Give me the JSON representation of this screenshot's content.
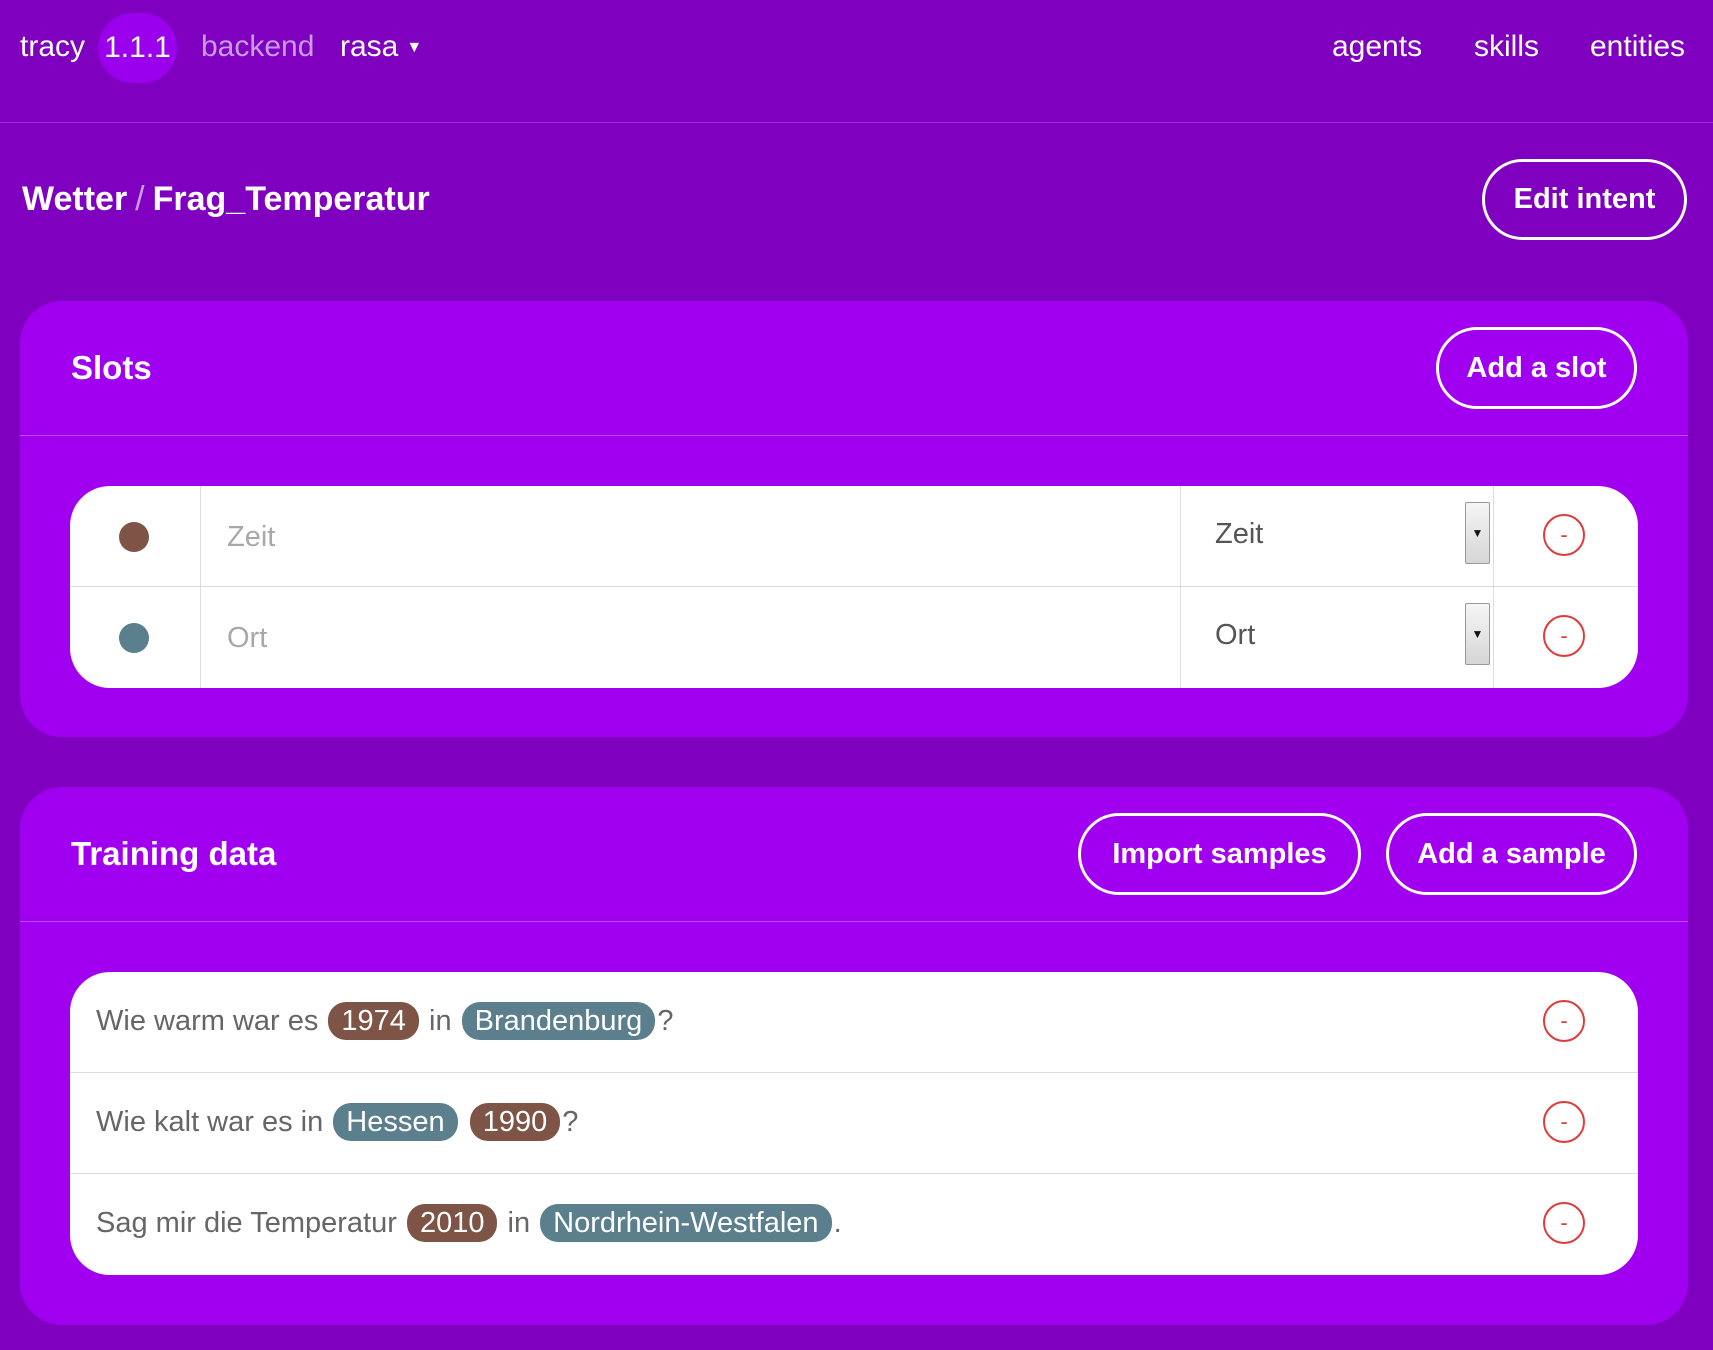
{
  "header": {
    "brand": "tracy",
    "version": "1.1.1",
    "backend_label": "backend",
    "backend_value": "rasa",
    "nav": [
      "agents",
      "skills",
      "entities"
    ]
  },
  "breadcrumb": {
    "parent": "Wetter",
    "separator": "/",
    "current": "Frag_Temperatur"
  },
  "edit_intent_label": "Edit intent",
  "slots": {
    "title": "Slots",
    "add_label": "Add a slot",
    "items": [
      {
        "placeholder": "Zeit",
        "entity": "Zeit",
        "color": "#7d5446"
      },
      {
        "placeholder": "Ort",
        "entity": "Ort",
        "color": "#5b7f8d"
      }
    ]
  },
  "training": {
    "title": "Training data",
    "import_label": "Import samples",
    "add_label": "Add a sample",
    "samples": [
      {
        "parts": [
          {
            "t": "Wie warm war es "
          },
          {
            "t": "1974",
            "slot": "zeit"
          },
          {
            "t": " in "
          },
          {
            "t": "Brandenburg",
            "slot": "ort"
          },
          {
            "t": "?"
          }
        ]
      },
      {
        "parts": [
          {
            "t": "Wie kalt war es in "
          },
          {
            "t": "Hessen",
            "slot": "ort"
          },
          {
            "t": " "
          },
          {
            "t": "1990",
            "slot": "zeit"
          },
          {
            "t": "?"
          }
        ]
      },
      {
        "parts": [
          {
            "t": "Sag mir die Temperatur "
          },
          {
            "t": "2010",
            "slot": "zeit"
          },
          {
            "t": " in "
          },
          {
            "t": "Nordrhein-Westfalen",
            "slot": "ort"
          },
          {
            "t": "."
          }
        ]
      }
    ]
  },
  "remove_symbol": "-",
  "colors": {
    "background": "#8000c0",
    "card": "#a100f0",
    "zeit": "#7d5446",
    "ort": "#5b7f8d",
    "danger": "#e03a3a"
  }
}
